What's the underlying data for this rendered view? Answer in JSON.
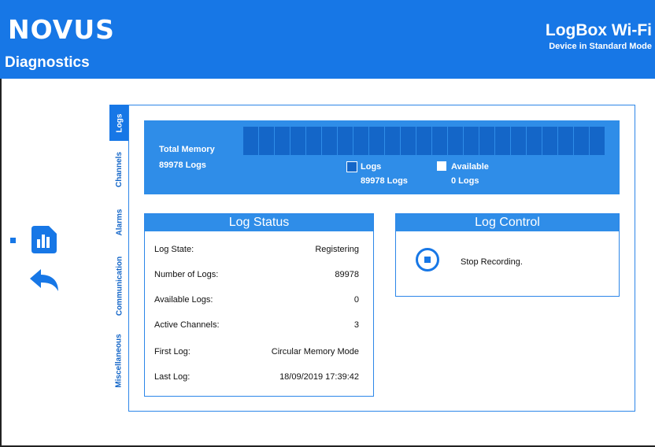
{
  "header": {
    "logo": "NOVUS",
    "page_title": "Diagnostics",
    "app_title": "LogBox Wi-Fi",
    "app_subtitle": "Device in Standard Mode"
  },
  "colors": {
    "accent": "#1777e6",
    "panel": "#2f8de8",
    "dark_block": "#1466c8"
  },
  "side_icons": [
    "chart-icon",
    "back-arrow-icon"
  ],
  "tabs": [
    {
      "label": "Logs",
      "active": true
    },
    {
      "label": "Channels",
      "active": false
    },
    {
      "label": "Alarms",
      "active": false
    },
    {
      "label": "Communication",
      "active": false
    },
    {
      "label": "Miscellaneous",
      "active": false
    }
  ],
  "memory": {
    "label": "Total Memory",
    "value": "89978 Logs",
    "used_fraction": 1.0,
    "legend": {
      "logs_label": "Logs",
      "logs_value": "89978 Logs",
      "available_label": "Available",
      "available_value": "0 Logs"
    }
  },
  "log_status": {
    "title": "Log Status",
    "rows": [
      {
        "label": "Log State:",
        "value": "Registering"
      },
      {
        "label": "Number of Logs:",
        "value": "89978"
      },
      {
        "label": "Available Logs:",
        "value": "0"
      },
      {
        "label": "Active Channels:",
        "value": "3"
      },
      {
        "label": "First Log:",
        "value": "Circular Memory Mode"
      },
      {
        "label": "Last Log:",
        "value": "18/09/2019 17:39:42"
      }
    ]
  },
  "log_control": {
    "title": "Log Control",
    "stop_label": "Stop Recording."
  }
}
